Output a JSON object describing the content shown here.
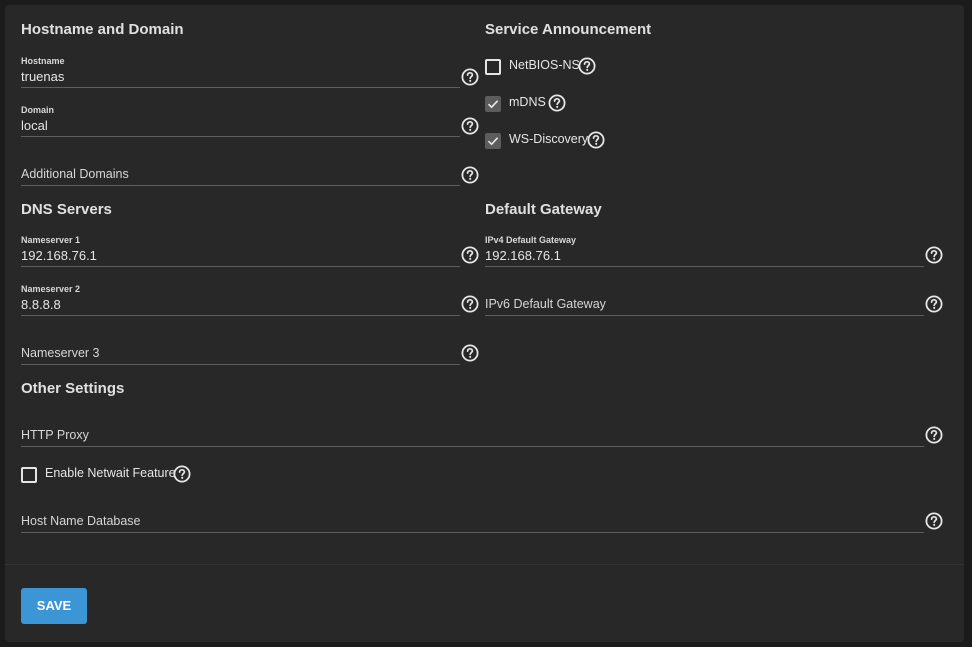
{
  "sections": {
    "hostname_domain": "Hostname and Domain",
    "service_announcement": "Service Announcement",
    "dns_servers": "DNS Servers",
    "default_gateway": "Default Gateway",
    "other_settings": "Other Settings"
  },
  "hostname": {
    "label": "Hostname",
    "value": "truenas"
  },
  "domain": {
    "label": "Domain",
    "value": "local"
  },
  "additional_domains": {
    "placeholder": "Additional Domains"
  },
  "netbios": {
    "label": "NetBIOS-NS",
    "checked": false
  },
  "mdns": {
    "label": "mDNS",
    "checked": true
  },
  "wsd": {
    "label": "WS-Discovery",
    "checked": true
  },
  "nameserver1": {
    "label": "Nameserver 1",
    "value": "192.168.76.1"
  },
  "nameserver2": {
    "label": "Nameserver 2",
    "value": "8.8.8.8"
  },
  "nameserver3": {
    "placeholder": "Nameserver 3"
  },
  "ipv4_gateway": {
    "label": "IPv4 Default Gateway",
    "value": "192.168.76.1"
  },
  "ipv6_gateway": {
    "placeholder": "IPv6 Default Gateway"
  },
  "http_proxy": {
    "placeholder": "HTTP Proxy"
  },
  "netwait": {
    "label": "Enable Netwait Feature",
    "checked": false
  },
  "host_name_database": {
    "placeholder": "Host Name Database"
  },
  "save_label": "SAVE",
  "icons": {
    "help": "help-circle-icon",
    "check": "checkmark-icon"
  },
  "colors": {
    "accent": "#3c95d4",
    "background": "#282828"
  }
}
